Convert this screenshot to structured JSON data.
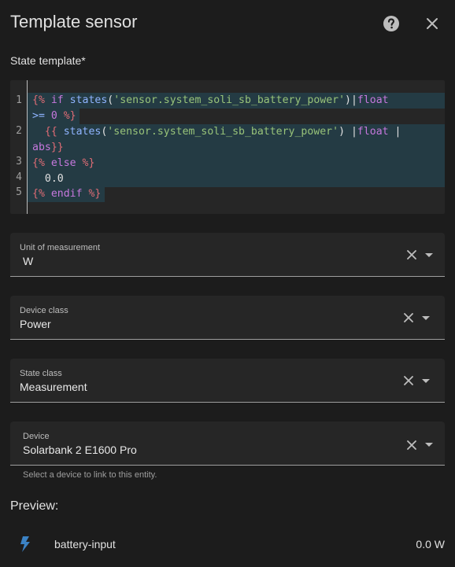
{
  "dialog": {
    "title": "Template sensor",
    "help_icon": "help-circle-icon",
    "close_icon": "close-icon"
  },
  "state_template": {
    "label": "State template*",
    "line_numbers": [
      "1",
      "2",
      "3",
      "4",
      "5"
    ],
    "lines": [
      {
        "tokens": [
          {
            "t": "{% ",
            "c": "delim"
          },
          {
            "t": "if ",
            "c": "kw"
          },
          {
            "t": "states",
            "c": "id"
          },
          {
            "t": "(",
            "c": "plain"
          },
          {
            "t": "'sensor.system_soli_sb_battery_power'",
            "c": "str"
          },
          {
            "t": ")",
            "c": "plain"
          },
          {
            "t": "|",
            "c": "plain"
          },
          {
            "t": "float",
            "c": "kw"
          }
        ]
      },
      {
        "tokens": [
          {
            "t": ">= ",
            "c": "id"
          },
          {
            "t": "0 ",
            "c": "kw"
          },
          {
            "t": "%}",
            "c": "delim"
          }
        ]
      },
      {
        "tokens": [
          {
            "t": "  {{ ",
            "c": "delim"
          },
          {
            "t": "states",
            "c": "id"
          },
          {
            "t": "(",
            "c": "plain"
          },
          {
            "t": "'sensor.system_soli_sb_battery_power'",
            "c": "str"
          },
          {
            "t": ") ",
            "c": "plain"
          },
          {
            "t": "|",
            "c": "plain"
          },
          {
            "t": "float",
            "c": "kw"
          },
          {
            "t": " |",
            "c": "plain"
          }
        ]
      },
      {
        "tokens": [
          {
            "t": "abs",
            "c": "kw"
          },
          {
            "t": "}}",
            "c": "delim"
          }
        ]
      },
      {
        "tokens": [
          {
            "t": "{% ",
            "c": "delim"
          },
          {
            "t": "else ",
            "c": "kw"
          },
          {
            "t": "%}",
            "c": "delim"
          }
        ]
      },
      {
        "tokens": [
          {
            "t": "  0.0",
            "c": "plain"
          }
        ]
      },
      {
        "tokens": [
          {
            "t": "{% ",
            "c": "delim"
          },
          {
            "t": "endif ",
            "c": "kw"
          },
          {
            "t": "%}",
            "c": "delim"
          }
        ]
      }
    ]
  },
  "fields": [
    {
      "label": "Unit of measurement",
      "value": "W"
    },
    {
      "label": "Device class",
      "value": "Power"
    },
    {
      "label": "State class",
      "value": "Measurement"
    },
    {
      "label": "Device",
      "value": "Solarbank 2 E1600 Pro"
    }
  ],
  "device_helper": "Select a device to link to this entity.",
  "preview": {
    "label": "Preview:",
    "entity_icon": "flash-icon",
    "entity_name": "battery-input",
    "entity_state": "0.0 W"
  },
  "colors": {
    "background": "#1c1c1c",
    "field_background": "#262626",
    "selection": "#243b44",
    "icon_blue": "#3b82c4"
  }
}
